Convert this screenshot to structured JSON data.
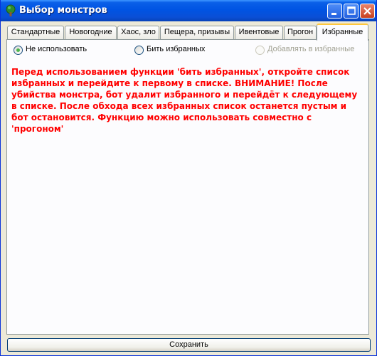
{
  "window": {
    "title": "Выбор монстров",
    "app_icon": "tree-icon",
    "controls": {
      "minimize": "minimize-icon",
      "maximize": "maximize-icon",
      "close": "close-icon"
    }
  },
  "tabs": [
    {
      "label": "Стандартные",
      "active": false
    },
    {
      "label": "Новогодние",
      "active": false
    },
    {
      "label": "Хаос, зло",
      "active": false
    },
    {
      "label": "Пещера, призывы",
      "active": false
    },
    {
      "label": "Ивентовые",
      "active": false
    },
    {
      "label": "Прогон",
      "active": false
    },
    {
      "label": "Избранные",
      "active": true
    }
  ],
  "options": [
    {
      "label": "Не использовать",
      "checked": true,
      "enabled": true
    },
    {
      "label": "Бить избранных",
      "checked": false,
      "enabled": true
    },
    {
      "label": "Добавлять в избранные",
      "checked": false,
      "enabled": false
    }
  ],
  "warning_text": "Перед использованием функции 'бить избранных', откройте список избранных и перейдите к первому в списке. ВНИМАНИЕ! После убийства монстра, бот удалит избранного и перейдёт к следующему в списке. После обхода всех избранных список останется пустым и бот остановится. Функцию можно использовать совместно с 'прогоном'",
  "save_label": "Сохранить",
  "colors": {
    "warning": "#ff0000",
    "titlebar": "#0054e3",
    "active_tab_accent": "#ffc73c"
  }
}
